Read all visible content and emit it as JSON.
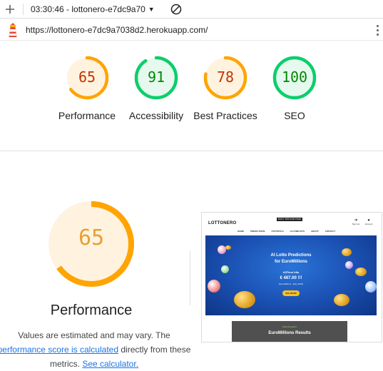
{
  "toolbar": {
    "report_label": "03:30:46 - lottonero-e7dc9a70",
    "url": "https://lottonero-e7dc9a7038d2.herokuapp.com/"
  },
  "colors": {
    "average_arc": "#ffa400",
    "average_fill": "#fff3e0",
    "average_text": "#c33300",
    "pass_arc": "#0cce6b",
    "pass_fill": "#e6f9ee",
    "pass_text": "#008800",
    "link": "#1a73e8"
  },
  "categories": [
    {
      "label": "Performance",
      "score": 65,
      "rating": "average"
    },
    {
      "label": "Accessibility",
      "score": 91,
      "rating": "pass"
    },
    {
      "label": "Best Practices",
      "score": 78,
      "rating": "average"
    },
    {
      "label": "SEO",
      "score": 100,
      "rating": "pass"
    }
  ],
  "performance": {
    "score": "65",
    "title": "Performance",
    "disclaimer_1": "Values are estimated and may vary. The",
    "link_score": "performance score is calculated",
    "disclaimer_2": "directly from these",
    "disclaimer_3": "metrics.",
    "link_calc": "See calculator."
  },
  "thumbnail": {
    "logo": "LOTTONERO",
    "strip": "DAILY TIPS FOR TRUE",
    "menu": [
      "HOME",
      "PREDICTIONS",
      "STATISTICS",
      "ALLTIME HITS",
      "ABOUT",
      "CONTACT"
    ],
    "signup": "Sign Up",
    "account": "Account",
    "headline_1": "AI Lotto Predictions",
    "headline_2": "for EuroMillions",
    "alltime_hits": "AllTime hits",
    "amount": "€ 467.00 !!!",
    "sub": "(EuroMillions - May 2023)",
    "button": "SEE MORE",
    "results_top": "Most Frequent",
    "results_title": "EuroMillions Results"
  }
}
